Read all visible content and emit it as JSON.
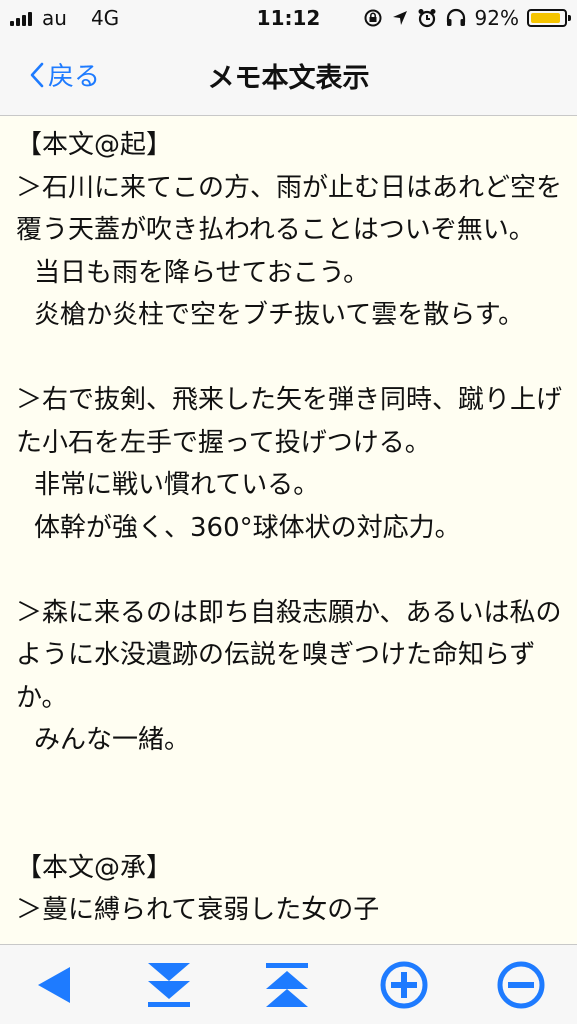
{
  "status_bar": {
    "carrier": "au",
    "network": "4G",
    "time": "11:12",
    "battery_percent": "92%",
    "battery_level": 0.92,
    "icons": [
      "rotation-lock-icon",
      "location-icon",
      "alarm-icon",
      "headphones-icon",
      "battery-icon"
    ]
  },
  "nav": {
    "back_label": "戻る",
    "title": "メモ本文表示"
  },
  "memo": {
    "paragraphs": [
      {
        "text": "【本文@起】",
        "indent": false
      },
      {
        "text": "＞石川に来てこの方、雨が止む日はあれど空を覆う天蓋が吹き払われることはついぞ無い。",
        "indent": false
      },
      {
        "text": "当日も雨を降らせておこう。",
        "indent": true
      },
      {
        "text": "炎槍か炎柱で空をブチ抜いて雲を散らす。",
        "indent": true
      },
      {
        "text": "",
        "indent": false
      },
      {
        "text": "＞右で抜剣、飛来した矢を弾き同時、蹴り上げた小石を左手で握って投げつける。",
        "indent": false
      },
      {
        "text": "非常に戦い慣れている。",
        "indent": true
      },
      {
        "text": "体幹が強く、360°球体状の対応力。",
        "indent": true
      },
      {
        "text": "",
        "indent": false
      },
      {
        "text": "＞森に来るのは即ち自殺志願か、あるいは私のように水没遺跡の伝説を嗅ぎつけた命知らずか。",
        "indent": false
      },
      {
        "text": "みんな一緒。",
        "indent": true
      },
      {
        "text": "",
        "indent": false
      },
      {
        "text": "",
        "indent": false
      },
      {
        "text": "【本文@承】",
        "indent": false
      },
      {
        "text": "＞蔓に縛られて衰弱した女の子",
        "indent": false
      }
    ]
  },
  "toolbar": {
    "buttons": [
      "back-triangle-icon",
      "scroll-to-bottom-icon",
      "scroll-to-top-icon",
      "zoom-in-icon",
      "zoom-out-icon"
    ],
    "accent_color": "#1e7bff"
  }
}
